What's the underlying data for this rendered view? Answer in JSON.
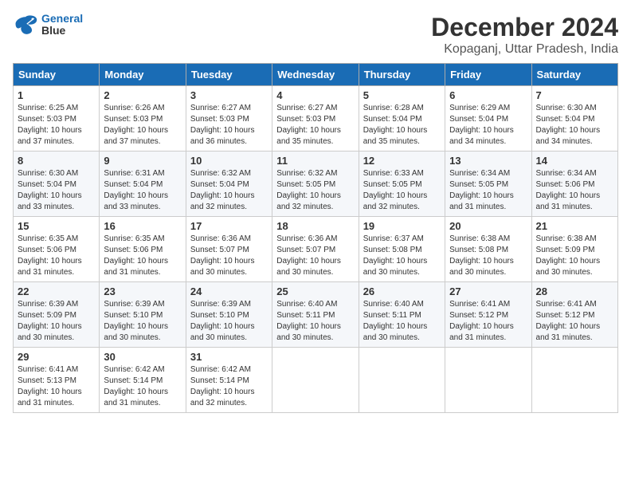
{
  "logo": {
    "line1": "General",
    "line2": "Blue"
  },
  "title": "December 2024",
  "location": "Kopaganj, Uttar Pradesh, India",
  "days_of_week": [
    "Sunday",
    "Monday",
    "Tuesday",
    "Wednesday",
    "Thursday",
    "Friday",
    "Saturday"
  ],
  "weeks": [
    [
      {
        "day": "1",
        "info": "Sunrise: 6:25 AM\nSunset: 5:03 PM\nDaylight: 10 hours\nand 37 minutes."
      },
      {
        "day": "2",
        "info": "Sunrise: 6:26 AM\nSunset: 5:03 PM\nDaylight: 10 hours\nand 37 minutes."
      },
      {
        "day": "3",
        "info": "Sunrise: 6:27 AM\nSunset: 5:03 PM\nDaylight: 10 hours\nand 36 minutes."
      },
      {
        "day": "4",
        "info": "Sunrise: 6:27 AM\nSunset: 5:03 PM\nDaylight: 10 hours\nand 35 minutes."
      },
      {
        "day": "5",
        "info": "Sunrise: 6:28 AM\nSunset: 5:04 PM\nDaylight: 10 hours\nand 35 minutes."
      },
      {
        "day": "6",
        "info": "Sunrise: 6:29 AM\nSunset: 5:04 PM\nDaylight: 10 hours\nand 34 minutes."
      },
      {
        "day": "7",
        "info": "Sunrise: 6:30 AM\nSunset: 5:04 PM\nDaylight: 10 hours\nand 34 minutes."
      }
    ],
    [
      {
        "day": "8",
        "info": "Sunrise: 6:30 AM\nSunset: 5:04 PM\nDaylight: 10 hours\nand 33 minutes."
      },
      {
        "day": "9",
        "info": "Sunrise: 6:31 AM\nSunset: 5:04 PM\nDaylight: 10 hours\nand 33 minutes."
      },
      {
        "day": "10",
        "info": "Sunrise: 6:32 AM\nSunset: 5:04 PM\nDaylight: 10 hours\nand 32 minutes."
      },
      {
        "day": "11",
        "info": "Sunrise: 6:32 AM\nSunset: 5:05 PM\nDaylight: 10 hours\nand 32 minutes."
      },
      {
        "day": "12",
        "info": "Sunrise: 6:33 AM\nSunset: 5:05 PM\nDaylight: 10 hours\nand 32 minutes."
      },
      {
        "day": "13",
        "info": "Sunrise: 6:34 AM\nSunset: 5:05 PM\nDaylight: 10 hours\nand 31 minutes."
      },
      {
        "day": "14",
        "info": "Sunrise: 6:34 AM\nSunset: 5:06 PM\nDaylight: 10 hours\nand 31 minutes."
      }
    ],
    [
      {
        "day": "15",
        "info": "Sunrise: 6:35 AM\nSunset: 5:06 PM\nDaylight: 10 hours\nand 31 minutes."
      },
      {
        "day": "16",
        "info": "Sunrise: 6:35 AM\nSunset: 5:06 PM\nDaylight: 10 hours\nand 31 minutes."
      },
      {
        "day": "17",
        "info": "Sunrise: 6:36 AM\nSunset: 5:07 PM\nDaylight: 10 hours\nand 30 minutes."
      },
      {
        "day": "18",
        "info": "Sunrise: 6:36 AM\nSunset: 5:07 PM\nDaylight: 10 hours\nand 30 minutes."
      },
      {
        "day": "19",
        "info": "Sunrise: 6:37 AM\nSunset: 5:08 PM\nDaylight: 10 hours\nand 30 minutes."
      },
      {
        "day": "20",
        "info": "Sunrise: 6:38 AM\nSunset: 5:08 PM\nDaylight: 10 hours\nand 30 minutes."
      },
      {
        "day": "21",
        "info": "Sunrise: 6:38 AM\nSunset: 5:09 PM\nDaylight: 10 hours\nand 30 minutes."
      }
    ],
    [
      {
        "day": "22",
        "info": "Sunrise: 6:39 AM\nSunset: 5:09 PM\nDaylight: 10 hours\nand 30 minutes."
      },
      {
        "day": "23",
        "info": "Sunrise: 6:39 AM\nSunset: 5:10 PM\nDaylight: 10 hours\nand 30 minutes."
      },
      {
        "day": "24",
        "info": "Sunrise: 6:39 AM\nSunset: 5:10 PM\nDaylight: 10 hours\nand 30 minutes."
      },
      {
        "day": "25",
        "info": "Sunrise: 6:40 AM\nSunset: 5:11 PM\nDaylight: 10 hours\nand 30 minutes."
      },
      {
        "day": "26",
        "info": "Sunrise: 6:40 AM\nSunset: 5:11 PM\nDaylight: 10 hours\nand 30 minutes."
      },
      {
        "day": "27",
        "info": "Sunrise: 6:41 AM\nSunset: 5:12 PM\nDaylight: 10 hours\nand 31 minutes."
      },
      {
        "day": "28",
        "info": "Sunrise: 6:41 AM\nSunset: 5:12 PM\nDaylight: 10 hours\nand 31 minutes."
      }
    ],
    [
      {
        "day": "29",
        "info": "Sunrise: 6:41 AM\nSunset: 5:13 PM\nDaylight: 10 hours\nand 31 minutes."
      },
      {
        "day": "30",
        "info": "Sunrise: 6:42 AM\nSunset: 5:14 PM\nDaylight: 10 hours\nand 31 minutes."
      },
      {
        "day": "31",
        "info": "Sunrise: 6:42 AM\nSunset: 5:14 PM\nDaylight: 10 hours\nand 32 minutes."
      },
      {
        "day": "",
        "info": ""
      },
      {
        "day": "",
        "info": ""
      },
      {
        "day": "",
        "info": ""
      },
      {
        "day": "",
        "info": ""
      }
    ]
  ]
}
